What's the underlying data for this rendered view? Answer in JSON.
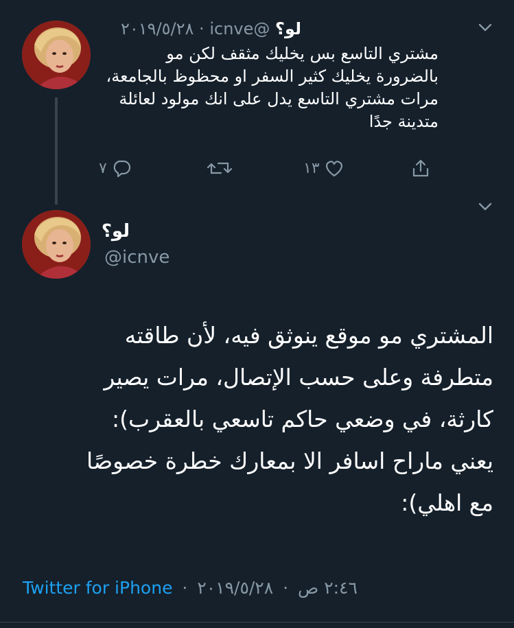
{
  "tweet1": {
    "display_name": "لو؟",
    "handle": "@icnve",
    "separator": "·",
    "date": "٢٠١٩/٥/٢٨",
    "lines": [
      "مشتري التاسع بس يخليك مثقف لكن مو",
      "بالضرورة يخليك كثير السفر او محظوظ بالجامعة،",
      "مرات مشتري التاسع يدل على انك مولود لعائلة",
      "متدينة جدًا"
    ],
    "reply_count": "٧",
    "retweet_count": "",
    "like_count": "١٣",
    "icons": [
      "reply-icon",
      "retweet-icon",
      "like-icon",
      "share-icon",
      "chevron-down-icon"
    ]
  },
  "tweet2": {
    "display_name": "لو؟",
    "handle": "@icnve",
    "lines": [
      "المشتري مو موقع ينوثق فيه، لأن طاقته",
      "متطرفة وعلى حسب الإتصال، مرات يصير",
      "كارثة، في وضعي حاكم تاسعي بالعقرب):",
      "يعني ماراح اسافر الا بمعارك خطرة خصوصًا",
      "مع اهلي):"
    ],
    "time": "٢:٤٦ ص",
    "date": "٢٠١٩/٥/٢٨",
    "separator": "·",
    "source": "Twitter for iPhone"
  },
  "colors": {
    "background": "#15202b",
    "text": "#ffffff",
    "muted": "#8899a6",
    "accent": "#1da1f2",
    "border": "#38444d"
  }
}
